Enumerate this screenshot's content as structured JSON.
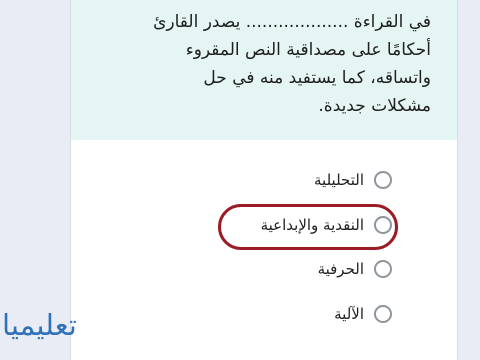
{
  "question": {
    "lines": [
      "في القراءة ................... يصدر القارئ",
      "أحكامًا على مصداقية النص المقروء",
      "واتساقه، كما يستفيد منه في حل",
      "مشكلات جديدة."
    ]
  },
  "options": [
    {
      "label": "التحليلية",
      "selected": false
    },
    {
      "label": "النقدية والإبداعية",
      "selected": false,
      "highlighted": true
    },
    {
      "label": "الحرفية",
      "selected": false
    },
    {
      "label": "الآلية",
      "selected": false
    }
  ],
  "colors": {
    "question_bg": "#e4f5f4",
    "highlight_ring": "#9b1c24",
    "watermark": "#2f72b8"
  },
  "watermark": "تعليميا"
}
